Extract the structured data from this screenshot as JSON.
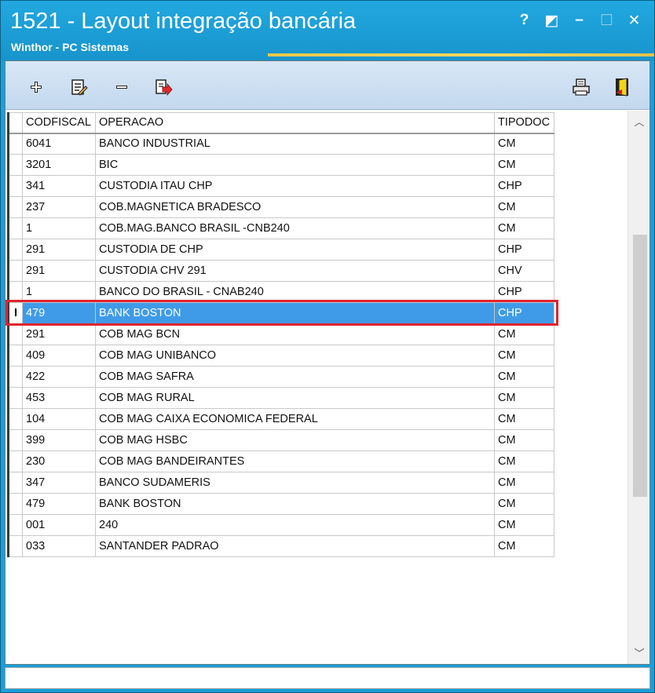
{
  "window": {
    "title": "1521 - Layout integração bancária",
    "subtitle": "Winthor - PC Sistemas",
    "buttons": {
      "help": "?",
      "restore": "◩",
      "minimize": "–",
      "maximize": "☐",
      "close": "✕"
    }
  },
  "toolbar": {
    "icons": [
      "add-icon",
      "edit-icon",
      "remove-icon",
      "export-icon",
      "print-icon",
      "exit-icon"
    ]
  },
  "grid": {
    "columns": [
      "CODFISCAL",
      "OPERACAO",
      "TIPODOC"
    ],
    "selected_marker": "I",
    "rows": [
      {
        "cod": "6041",
        "op": "BANCO INDUSTRIAL",
        "tipo": "CM"
      },
      {
        "cod": "3201",
        "op": "BIC",
        "tipo": "CM"
      },
      {
        "cod": "341",
        "op": "CUSTODIA ITAU CHP",
        "tipo": "CHP"
      },
      {
        "cod": "237",
        "op": "COB.MAGNETICA BRADESCO",
        "tipo": "CM"
      },
      {
        "cod": "1",
        "op": "COB.MAG.BANCO BRASIL -CNB240",
        "tipo": "CM"
      },
      {
        "cod": "291",
        "op": "CUSTODIA DE CHP",
        "tipo": "CHP"
      },
      {
        "cod": "291",
        "op": "CUSTODIA CHV 291",
        "tipo": "CHV"
      },
      {
        "cod": "1",
        "op": "BANCO DO BRASIL - CNAB240",
        "tipo": "CHP"
      },
      {
        "cod": "479",
        "op": "BANK BOSTON",
        "tipo": "CHP"
      },
      {
        "cod": "291",
        "op": "COB MAG BCN",
        "tipo": "CM"
      },
      {
        "cod": "409",
        "op": "COB MAG UNIBANCO",
        "tipo": "CM"
      },
      {
        "cod": "422",
        "op": "COB MAG SAFRA",
        "tipo": "CM"
      },
      {
        "cod": "453",
        "op": "COB MAG RURAL",
        "tipo": "CM"
      },
      {
        "cod": "104",
        "op": "COB MAG CAIXA ECONOMICA FEDERAL",
        "tipo": "CM"
      },
      {
        "cod": "399",
        "op": "COB MAG HSBC",
        "tipo": "CM"
      },
      {
        "cod": "230",
        "op": "COB MAG BANDEIRANTES",
        "tipo": "CM"
      },
      {
        "cod": "347",
        "op": "BANCO SUDAMERIS",
        "tipo": "CM"
      },
      {
        "cod": "479",
        "op": "BANK BOSTON",
        "tipo": "CM"
      },
      {
        "cod": "001",
        "op": "240",
        "tipo": "CM"
      },
      {
        "cod": "033",
        "op": "SANTANDER PADRAO",
        "tipo": "CM"
      }
    ],
    "selected_index": 8
  },
  "colors": {
    "titlebar": "#1b9fd6",
    "selection": "#3f9be8",
    "highlight_outline": "#e0232e"
  }
}
